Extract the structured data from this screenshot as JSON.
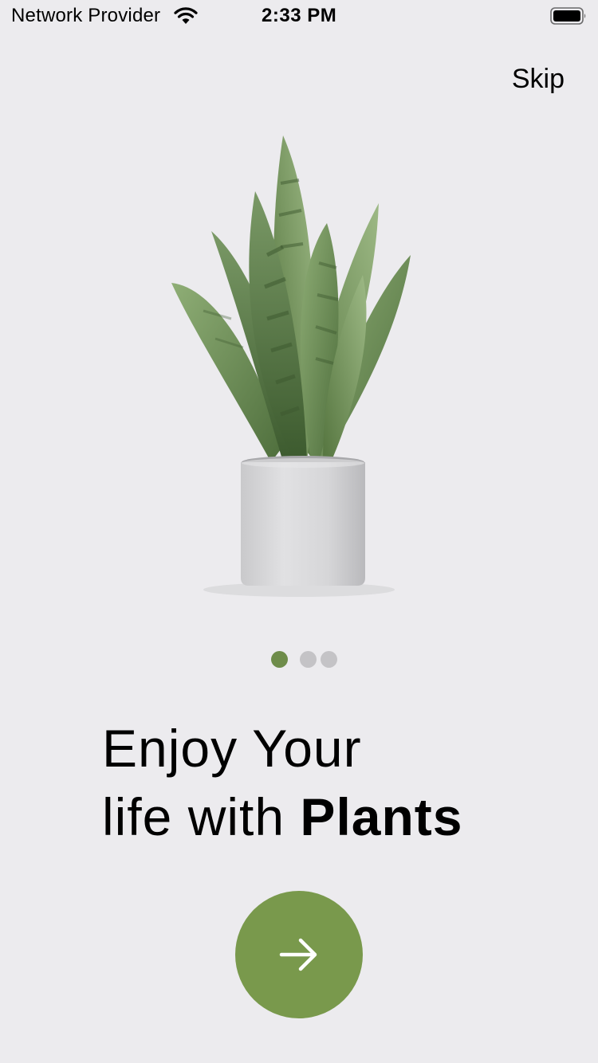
{
  "status_bar": {
    "carrier": "Network Provider",
    "time": "2:33 PM",
    "wifi_icon": "wifi-icon",
    "battery_icon": "battery-full-icon"
  },
  "header": {
    "skip_label": "Skip"
  },
  "hero": {
    "image": "snake-plant-in-white-pot"
  },
  "pager": {
    "count": 3,
    "active_index": 0,
    "active_color": "#6E8C4A",
    "inactive_color": "#C4C3C6"
  },
  "headline": {
    "line1": "Enjoy Your",
    "line2_regular": "life with ",
    "line2_bold": "Plants"
  },
  "next_button": {
    "icon": "arrow-right-icon",
    "color": "#79994C"
  },
  "colors": {
    "background": "#ECEBEE",
    "accent": "#79994C"
  }
}
